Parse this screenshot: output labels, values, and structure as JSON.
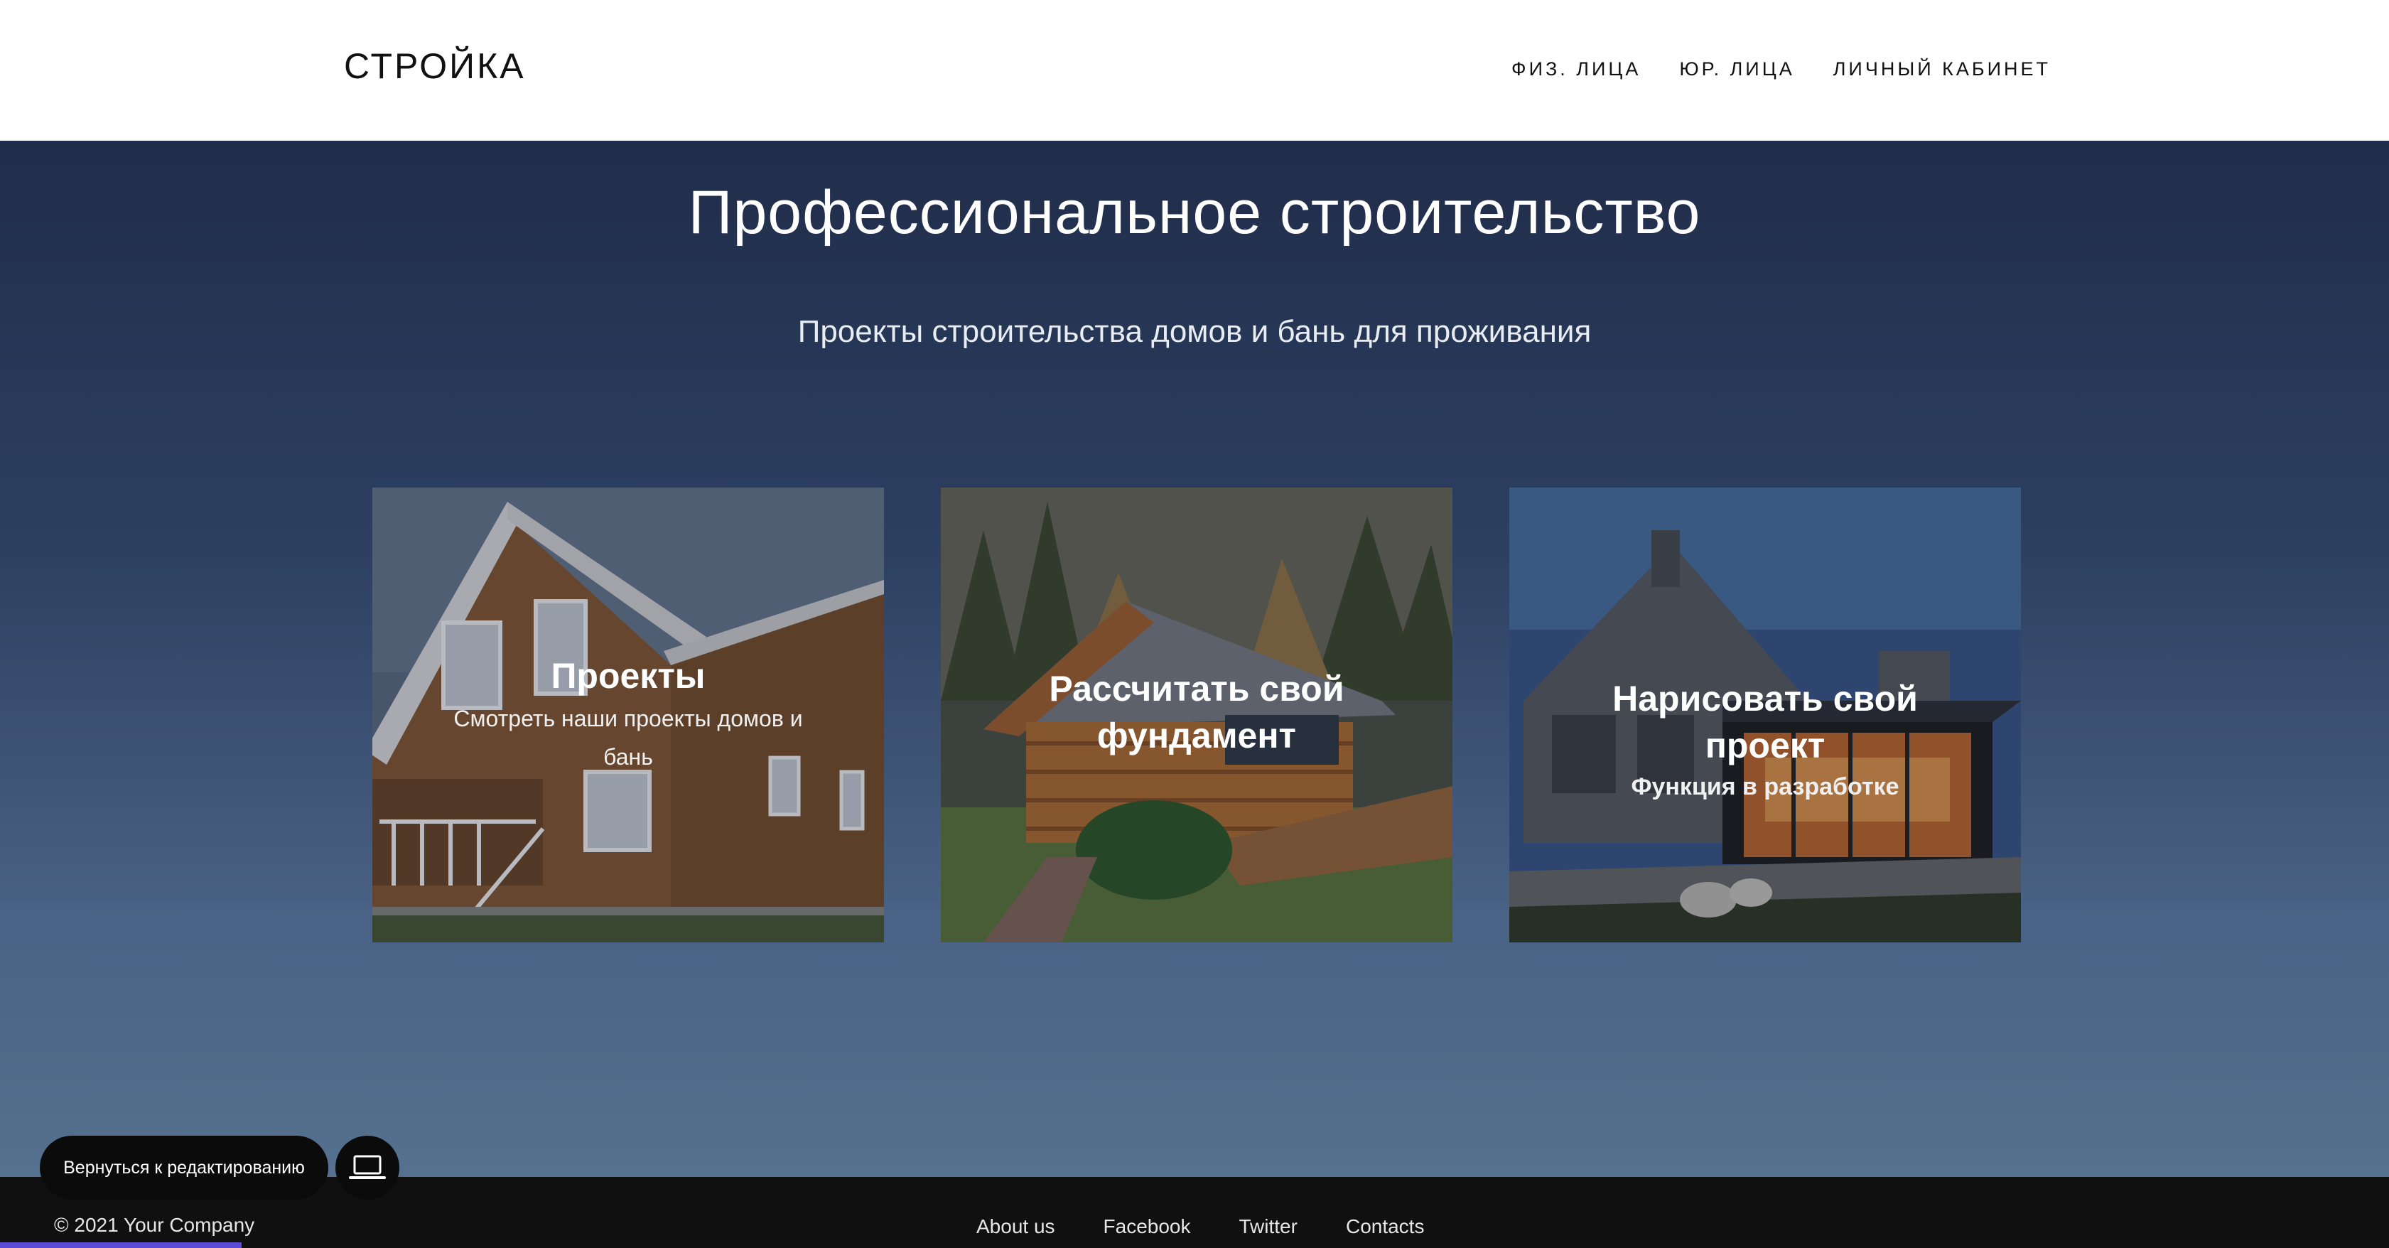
{
  "header": {
    "logo": "СТРОЙКА",
    "nav": [
      "ФИЗ. ЛИЦА",
      "ЮР. ЛИЦА",
      "ЛИЧНЫЙ КАБИНЕТ"
    ]
  },
  "hero": {
    "title": "Профессиональное строительство",
    "subtitle": "Проекты строительства домов и бань для проживания"
  },
  "cards": [
    {
      "title": "Проекты",
      "description": "Смотреть наши проекты домов и бань"
    },
    {
      "title": "Рассчитать свой фундамент",
      "description": ""
    },
    {
      "title": "Нарисовать свой проект",
      "description": "Функция в разработке"
    }
  ],
  "footer": {
    "copyright": "© 2021 Your Company",
    "links": [
      "About us",
      "Facebook",
      "Twitter",
      "Contacts"
    ]
  },
  "editor": {
    "back_label": "Вернуться к редактированию",
    "device_icon": "laptop-icon"
  },
  "colors": {
    "hero_top": "#202d4a",
    "hero_bottom": "#56708f",
    "footer_bg": "#101010"
  }
}
